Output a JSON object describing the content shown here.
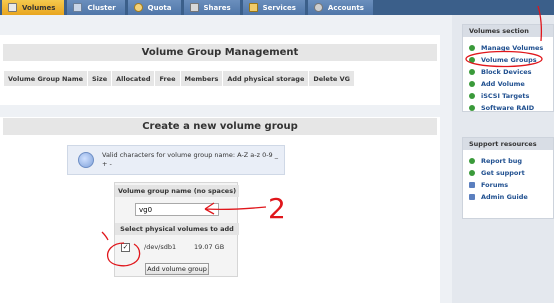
{
  "tabs": [
    {
      "label": "Volumes",
      "icon": "volumes-icon",
      "active": true
    },
    {
      "label": "Cluster",
      "icon": "cluster-icon"
    },
    {
      "label": "Quota",
      "icon": "quota-icon"
    },
    {
      "label": "Shares",
      "icon": "shares-icon"
    },
    {
      "label": "Services",
      "icon": "services-icon"
    },
    {
      "label": "Accounts",
      "icon": "accounts-icon"
    }
  ],
  "vg_section": {
    "title": "Volume Group Management",
    "columns": [
      "Volume Group Name",
      "Size",
      "Allocated",
      "Free",
      "Members",
      "Add physical storage",
      "Delete VG"
    ]
  },
  "create_section": {
    "title": "Create a new volume group",
    "hint": "Valid characters for volume group name: A-Z a-z 0-9 _ + -",
    "name_label": "Volume group name (no spaces)",
    "name_value": "vg0",
    "pv_label": "Select physical volumes to add",
    "pv": {
      "device": "/dev/sdb1",
      "size": "19.07 GB",
      "checked": true
    },
    "add_button": "Add volume group"
  },
  "volumes_section": {
    "title": "Volumes section",
    "items": [
      "Manage Volumes",
      "Volume Groups",
      "Block Devices",
      "Add Volume",
      "iSCSI Targets",
      "Software RAID"
    ]
  },
  "support_section": {
    "title": "Support resources",
    "items": [
      "Report bug",
      "Get support",
      "Forums",
      "Admin Guide"
    ]
  },
  "annotations": {
    "color": "#e0161b",
    "marks": [
      "2"
    ]
  }
}
